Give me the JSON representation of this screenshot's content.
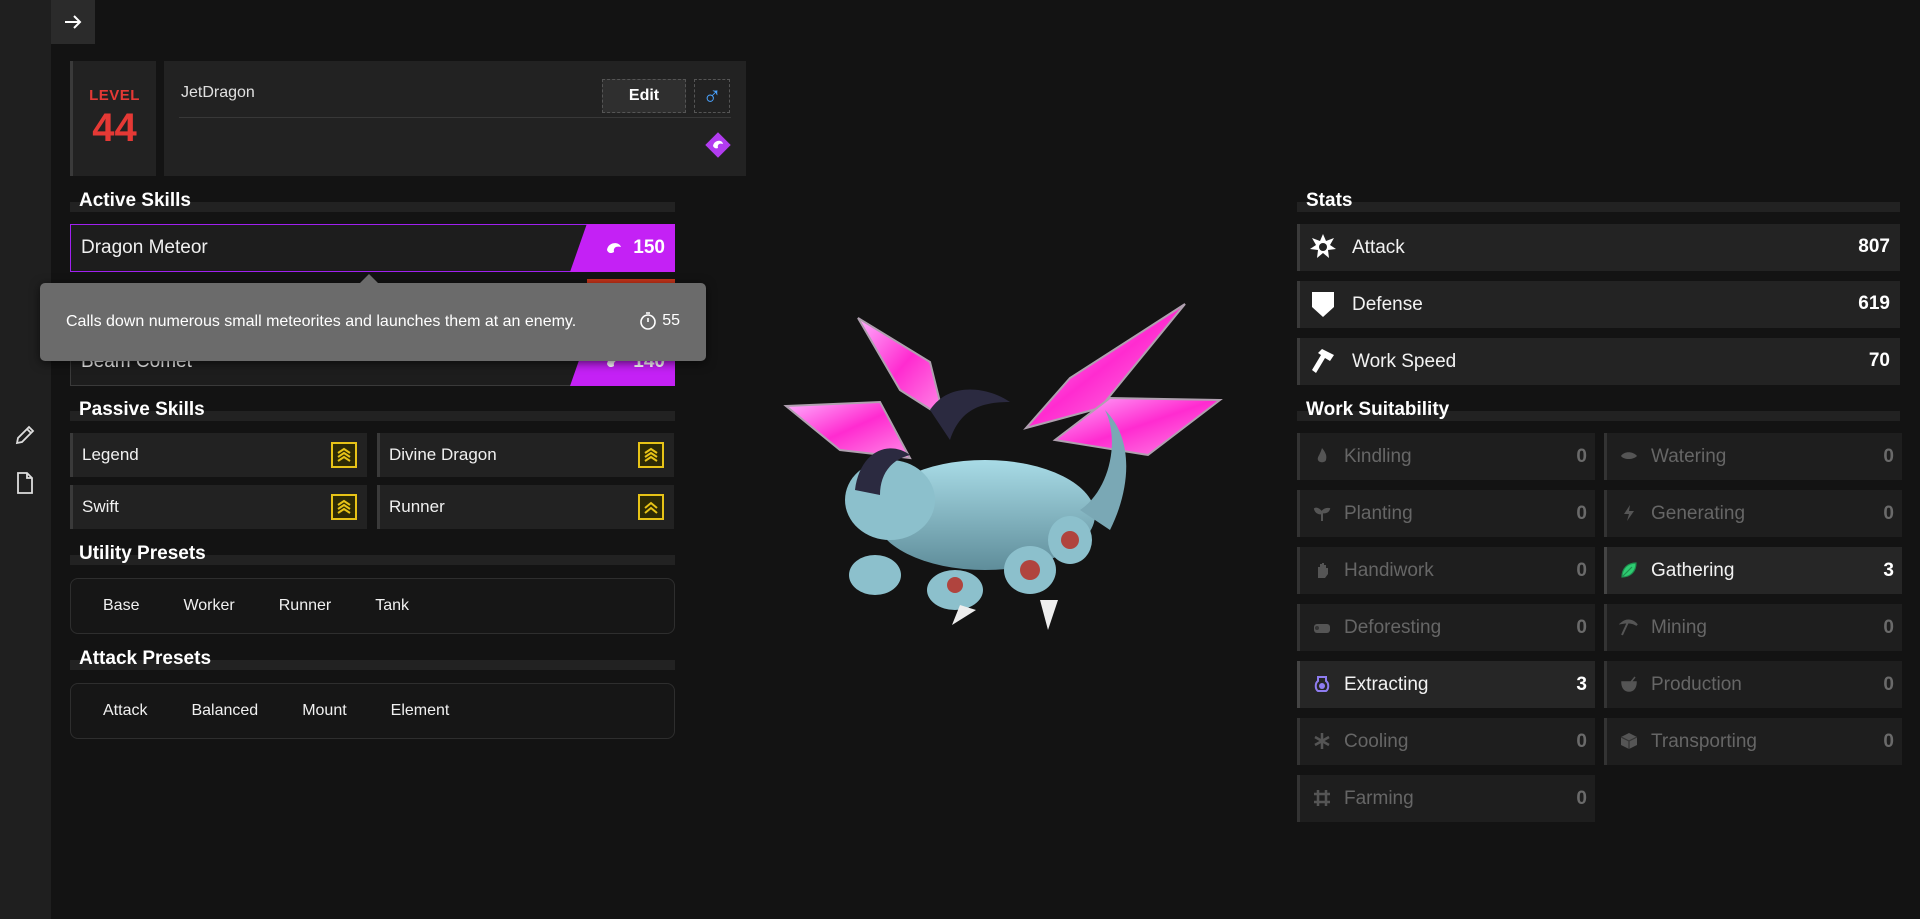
{
  "header": {
    "level_label": "LEVEL",
    "level": "44",
    "nickname": "JetDragon",
    "edit_label": "Edit",
    "gender_symbol": "♂"
  },
  "sections": {
    "active_skills": "Active Skills",
    "passive_skills": "Passive Skills",
    "utility_presets": "Utility Presets",
    "attack_presets": "Attack Presets",
    "stats": "Stats",
    "work_suitability": "Work Suitability"
  },
  "active_skills": [
    {
      "name": "Dragon Meteor",
      "power": "150"
    },
    {
      "name": "Beam Comet",
      "power": "140"
    }
  ],
  "tooltip": {
    "text": "Calls down numerous small meteorites and launches them at an enemy.",
    "cooldown": "55"
  },
  "passive_skills": [
    {
      "name": "Legend"
    },
    {
      "name": "Divine Dragon"
    },
    {
      "name": "Swift"
    },
    {
      "name": "Runner"
    }
  ],
  "utility_presets": [
    "Base",
    "Worker",
    "Runner",
    "Tank"
  ],
  "attack_presets": [
    "Attack",
    "Balanced",
    "Mount",
    "Element"
  ],
  "stats": [
    {
      "label": "Attack",
      "value": "807",
      "icon": "attack-icon"
    },
    {
      "label": "Defense",
      "value": "619",
      "icon": "defense-icon"
    },
    {
      "label": "Work Speed",
      "value": "70",
      "icon": "work-speed-icon"
    }
  ],
  "work": [
    {
      "label": "Kindling",
      "value": "0"
    },
    {
      "label": "Watering",
      "value": "0"
    },
    {
      "label": "Planting",
      "value": "0"
    },
    {
      "label": "Generating",
      "value": "0"
    },
    {
      "label": "Handiwork",
      "value": "0"
    },
    {
      "label": "Gathering",
      "value": "3"
    },
    {
      "label": "Deforesting",
      "value": "0"
    },
    {
      "label": "Mining",
      "value": "0"
    },
    {
      "label": "Extracting",
      "value": "3"
    },
    {
      "label": "Production",
      "value": "0"
    },
    {
      "label": "Cooling",
      "value": "0"
    },
    {
      "label": "Transporting",
      "value": "0"
    },
    {
      "label": "Farming",
      "value": "0"
    }
  ],
  "colors": {
    "level_red": "#e53935",
    "skill_purple": "#c421f5",
    "rank_gold": "#e7c317",
    "gender_blue": "#4aa3ff",
    "gathering_green": "#2ecc71",
    "extracting_purple": "#8e7cf0"
  }
}
